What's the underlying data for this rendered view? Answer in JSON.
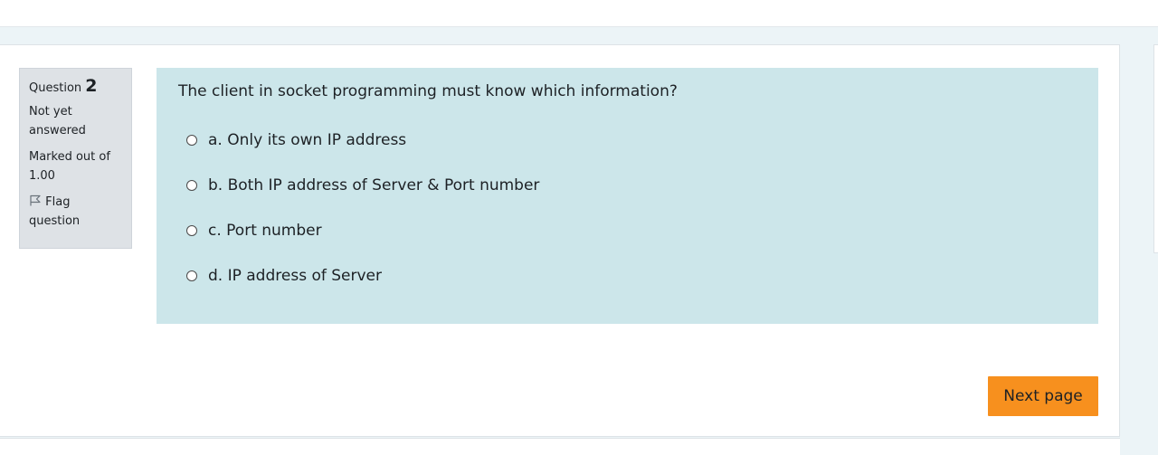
{
  "question_info": {
    "label": "Question",
    "number": "2",
    "state": "Not yet answered",
    "grade": "Marked out of 1.00",
    "flag_label": "Flag question"
  },
  "question": {
    "text": "The client in socket programming must know which information?",
    "answers": [
      {
        "label": "a.  Only its own IP address",
        "selected": false
      },
      {
        "label": "b. Both IP address of Server & Port number",
        "selected": false
      },
      {
        "label": "c. Port number",
        "selected": false
      },
      {
        "label": "d. IP address of Server",
        "selected": false
      }
    ]
  },
  "navigation": {
    "next_label": "Next page"
  },
  "colors": {
    "accent": "#f7901e",
    "question_bg": "#cce6ea",
    "info_bg": "#dee2e6",
    "page_bg": "#ecf4f7"
  },
  "icons": {
    "flag": "flag-outline-icon",
    "radio": "radio-unchecked-icon"
  }
}
